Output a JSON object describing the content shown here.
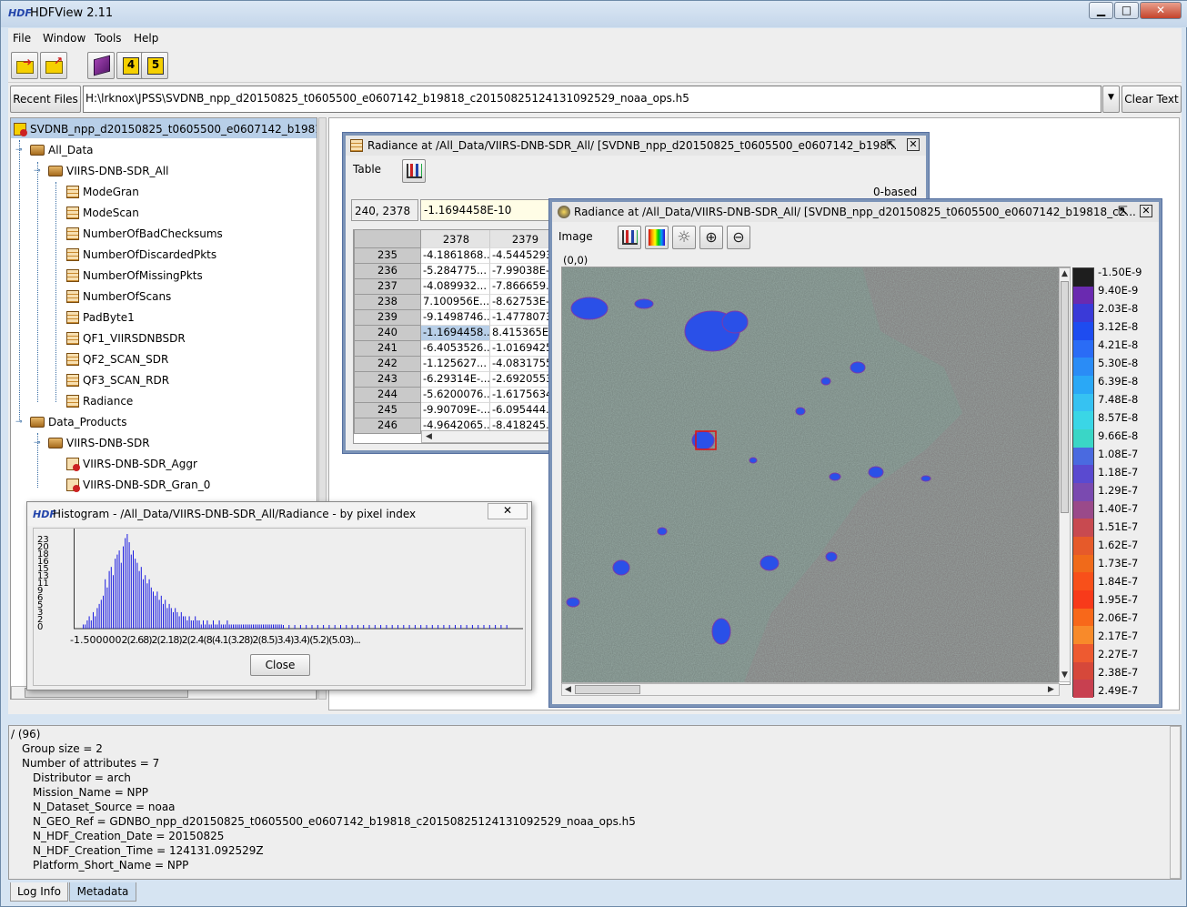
{
  "window": {
    "title": "HDFView 2.11",
    "logo": "HDF",
    "min": "▁",
    "max": "□",
    "close": "✕"
  },
  "menu": [
    "File",
    "Window",
    "Tools",
    "Help"
  ],
  "toolbar": {
    "icons": [
      "open-file-icon",
      "open-folder-icon",
      "users-guide-book-icon",
      "hdf4-library-icon",
      "hdf5-library-icon"
    ],
    "h4": "4",
    "h5": "5"
  },
  "recent": {
    "label": "Recent Files",
    "path": "H:\\lrknox\\JPSS\\SVDNB_npp_d20150825_t0605500_e0607142_b19818_c20150825124131092529_noaa_ops.h5",
    "clear": "Clear Text",
    "dropdown": "▼"
  },
  "tree": {
    "root": "SVDNB_npp_d20150825_t0605500_e0607142_b19818_",
    "all_data": "All_Data",
    "viirs_all": "VIIRS-DNB-SDR_All",
    "datasets": [
      "ModeGran",
      "ModeScan",
      "NumberOfBadChecksums",
      "NumberOfDiscardedPkts",
      "NumberOfMissingPkts",
      "NumberOfScans",
      "PadByte1",
      "QF1_VIIRSDNBSDR",
      "QF2_SCAN_SDR",
      "QF3_SCAN_RDR",
      "Radiance"
    ],
    "data_products": "Data_Products",
    "viirs_sdr": "VIIRS-DNB-SDR",
    "products": [
      "VIIRS-DNB-SDR_Aggr",
      "VIIRS-DNB-SDR_Gran_0"
    ]
  },
  "table": {
    "title": "Radiance  at  /All_Data/VIIRS-DNB-SDR_All/  [SVDNB_npp_d20150825_t0605500_e0607142_b198...",
    "menu": "Table",
    "based": "0-based",
    "cell_ref": "240, 2378",
    "cell_value": "-1.1694458E-10",
    "columns": [
      "2378",
      "2379"
    ],
    "rows": [
      {
        "r": "235",
        "a": "-4.1861868...",
        "b": "-4.5445293"
      },
      {
        "r": "236",
        "a": "-5.284775...",
        "b": "-7.99038E-"
      },
      {
        "r": "237",
        "a": "-4.089932...",
        "b": "-7.866659..."
      },
      {
        "r": "238",
        "a": "7.100956E...",
        "b": "-8.62753E-"
      },
      {
        "r": "239",
        "a": "-9.1498746...",
        "b": "-1.4778073"
      },
      {
        "r": "240",
        "a": "-1.1694458...",
        "b": "8.415365E..."
      },
      {
        "r": "241",
        "a": "-6.4053526...",
        "b": "-1.0169425"
      },
      {
        "r": "242",
        "a": "-1.125627...",
        "b": "-4.0831755"
      },
      {
        "r": "243",
        "a": "-6.29314E-...",
        "b": "-2.6920553"
      },
      {
        "r": "244",
        "a": "-5.6200076...",
        "b": "-1.6175634"
      },
      {
        "r": "245",
        "a": "-9.90709E-...",
        "b": "-6.095444..."
      },
      {
        "r": "246",
        "a": "-4.9642065...",
        "b": "-8.418245..."
      }
    ]
  },
  "image": {
    "title": "Radiance  at  /All_Data/VIIRS-DNB-SDR_All/  [SVDNB_npp_d20150825_t0605500_e0607142_b19818_c2...",
    "menu": "Image",
    "coord": "(0,0)",
    "colorbar": [
      "-1.50E-9",
      "9.40E-9",
      "2.03E-8",
      "3.12E-8",
      "4.21E-8",
      "5.30E-8",
      "6.39E-8",
      "7.48E-8",
      "8.57E-8",
      "9.66E-8",
      "1.08E-7",
      "1.18E-7",
      "1.29E-7",
      "1.40E-7",
      "1.51E-7",
      "1.62E-7",
      "1.73E-7",
      "1.84E-7",
      "1.95E-7",
      "2.06E-7",
      "2.17E-7",
      "2.27E-7",
      "2.38E-7",
      "2.49E-7"
    ],
    "colorbar_colors": [
      "#1e1e1e",
      "#6a2ab0",
      "#3a3ad8",
      "#1e4cf0",
      "#2a6cf6",
      "#2a8cf6",
      "#2aa8f6",
      "#36c2f2",
      "#3ad6e6",
      "#3ad6c6",
      "#4a6ae0",
      "#5a4ad0",
      "#7a4ab0",
      "#9a4a8a",
      "#c84a50",
      "#e65a2a",
      "#f06a1a",
      "#f8501a",
      "#f83a1a",
      "#f8681a",
      "#f88a2a",
      "#ee5a30",
      "#d6483a",
      "#c84050"
    ]
  },
  "histogram": {
    "title": "Histogram - /All_Data/VIIRS-DNB-SDR_All/Radiance - by pixel index",
    "close": "Close",
    "x_text": "-1.500000",
    "x_tail": "2(2.68)2(2.18)2(2.4(8(4.1(3.28)2(8.5)3.4)3.4)(5.2)(5.03)...",
    "yticks": [
      "23",
      "20",
      "18",
      "16",
      "15",
      "13",
      "11",
      "9",
      "6",
      "5",
      "3",
      "2",
      "0"
    ],
    "bars": [
      1,
      1,
      2,
      3,
      2,
      4,
      3,
      5,
      6,
      7,
      8,
      12,
      10,
      14,
      15,
      13,
      17,
      18,
      19,
      16,
      20,
      22,
      23,
      21,
      18,
      19,
      17,
      16,
      14,
      15,
      12,
      13,
      11,
      12,
      10,
      9,
      8,
      9,
      7,
      8,
      6,
      7,
      5,
      6,
      5,
      4,
      5,
      4,
      3,
      4,
      3,
      3,
      2,
      3,
      2,
      2,
      3,
      2,
      2,
      1,
      2,
      1,
      2,
      1,
      1,
      2,
      1,
      1,
      2,
      1,
      1,
      1,
      2,
      1,
      1,
      1,
      1,
      1,
      1,
      1,
      1,
      1,
      1,
      1,
      1,
      1,
      1,
      1,
      1,
      1,
      1,
      1,
      1,
      1,
      1,
      1,
      1,
      1,
      1,
      1
    ]
  },
  "metadata": {
    "lines": [
      "/ (96)",
      "Group size = 2",
      "Number of attributes = 7",
      "Distributor = arch",
      "Mission_Name = NPP",
      "N_Dataset_Source = noaa",
      "N_GEO_Ref = GDNBO_npp_d20150825_t0605500_e0607142_b19818_c20150825124131092529_noaa_ops.h5",
      "N_HDF_Creation_Date = 20150825",
      "N_HDF_Creation_Time = 124131.092529Z",
      "Platform_Short_Name = NPP"
    ],
    "tabs": [
      "Log Info",
      "Metadata"
    ]
  }
}
